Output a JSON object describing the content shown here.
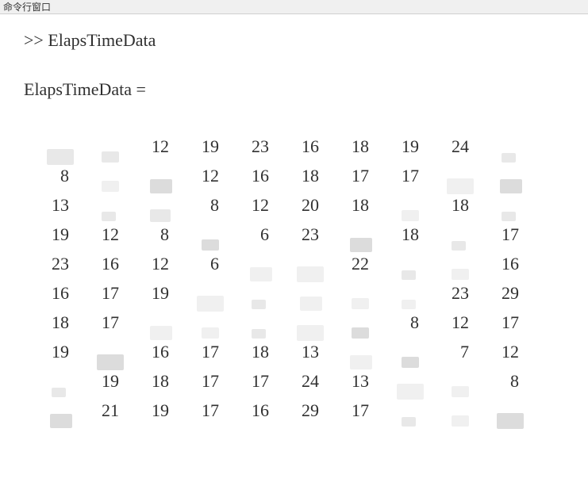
{
  "titlebar": "命令行窗口",
  "prompt": ">> ElapsTimeData",
  "result_label": "ElapsTimeData =",
  "matrix": [
    [
      "",
      "",
      "12",
      "19",
      "23",
      "16",
      "18",
      "19",
      "24",
      ""
    ],
    [
      "8",
      "",
      "",
      "12",
      "16",
      "18",
      "17",
      "17",
      "",
      ""
    ],
    [
      "13",
      "",
      "",
      "8",
      "12",
      "20",
      "18",
      "",
      "18",
      ""
    ],
    [
      "19",
      "12",
      "8",
      "",
      "6",
      "23",
      "",
      "18",
      "",
      "17"
    ],
    [
      "23",
      "16",
      "12",
      "6",
      "",
      "",
      "22",
      "",
      "",
      "16"
    ],
    [
      "16",
      "17",
      "19",
      "",
      "",
      "",
      "",
      "",
      "23",
      "29"
    ],
    [
      "18",
      "17",
      "",
      "",
      "",
      "",
      "",
      "8",
      "12",
      "17"
    ],
    [
      "19",
      "",
      "16",
      "17",
      "18",
      "13",
      "",
      "",
      "7",
      "12"
    ],
    [
      "",
      "19",
      "18",
      "17",
      "17",
      "24",
      "13",
      "",
      "",
      "8"
    ],
    [
      "",
      "21",
      "19",
      "17",
      "16",
      "29",
      "17",
      "",
      "",
      ""
    ]
  ],
  "smudge_map": [
    [
      "c",
      "b",
      "",
      "",
      "",
      "",
      "",
      "",
      "",
      "d"
    ],
    [
      "",
      "light b",
      "mid a",
      "",
      "",
      "",
      "",
      "",
      "light c",
      "mid a"
    ],
    [
      "",
      "d",
      "e",
      "",
      "",
      "",
      "",
      "light b",
      "",
      "d"
    ],
    [
      "",
      "",
      "",
      "mid b",
      "",
      "",
      "mid a",
      "",
      "d",
      ""
    ],
    [
      "",
      "",
      "",
      "",
      "light a",
      "light c",
      "",
      "d",
      "light b",
      ""
    ],
    [
      "",
      "",
      "",
      "light c",
      "d",
      "light a",
      "light b",
      "light d",
      "",
      ""
    ],
    [
      "",
      "",
      "light a",
      "light b",
      "d",
      "light c",
      "mid b",
      "",
      "",
      ""
    ],
    [
      "",
      "mid c",
      "",
      "",
      "",
      "",
      "light a",
      "mid b",
      "",
      ""
    ],
    [
      "d",
      "",
      "",
      "",
      "",
      "",
      "",
      "light c",
      "light b",
      ""
    ],
    [
      "mid a",
      "",
      "",
      "",
      "",
      "",
      "",
      "d",
      "light b",
      "mid c"
    ]
  ]
}
